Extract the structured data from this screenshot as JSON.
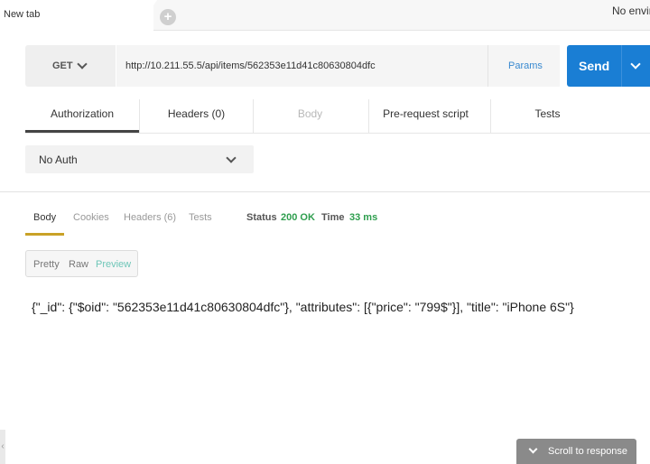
{
  "tabs": {
    "active_label": "New tab",
    "new_tab_icon": "plus-icon"
  },
  "environment": {
    "label": "No envir"
  },
  "request": {
    "method": "GET",
    "url": "http://10.211.55.5/api/items/562353e11d41c80630804dfc",
    "params_label": "Params",
    "send_label": "Send"
  },
  "request_tabs": [
    {
      "label": "Authorization",
      "active": true
    },
    {
      "label": "Headers (0)"
    },
    {
      "label": "Body",
      "disabled": true
    },
    {
      "label": "Pre-request script"
    },
    {
      "label": "Tests"
    }
  ],
  "auth": {
    "selected": "No Auth"
  },
  "response": {
    "tabs": [
      "Body",
      "Cookies",
      "Headers (6)",
      "Tests"
    ],
    "status_label": "Status",
    "status_value": "200 OK",
    "time_label": "Time",
    "time_value": "33 ms",
    "formats": [
      "Pretty",
      "Raw",
      "Preview"
    ],
    "active_format": "Preview",
    "body": "{\"_id\": {\"$oid\": \"562353e11d41c80630804dfc\"}, \"attributes\": [{\"price\": \"799$\"}], \"title\": \"iPhone 6S\"}"
  },
  "scroll_button": {
    "label": "Scroll to response"
  },
  "colors": {
    "send_blue": "#1a7ed4",
    "status_green": "#2e9e4e",
    "body_tab_underline": "#c9a227",
    "preview_teal": "#6ec6b8"
  }
}
